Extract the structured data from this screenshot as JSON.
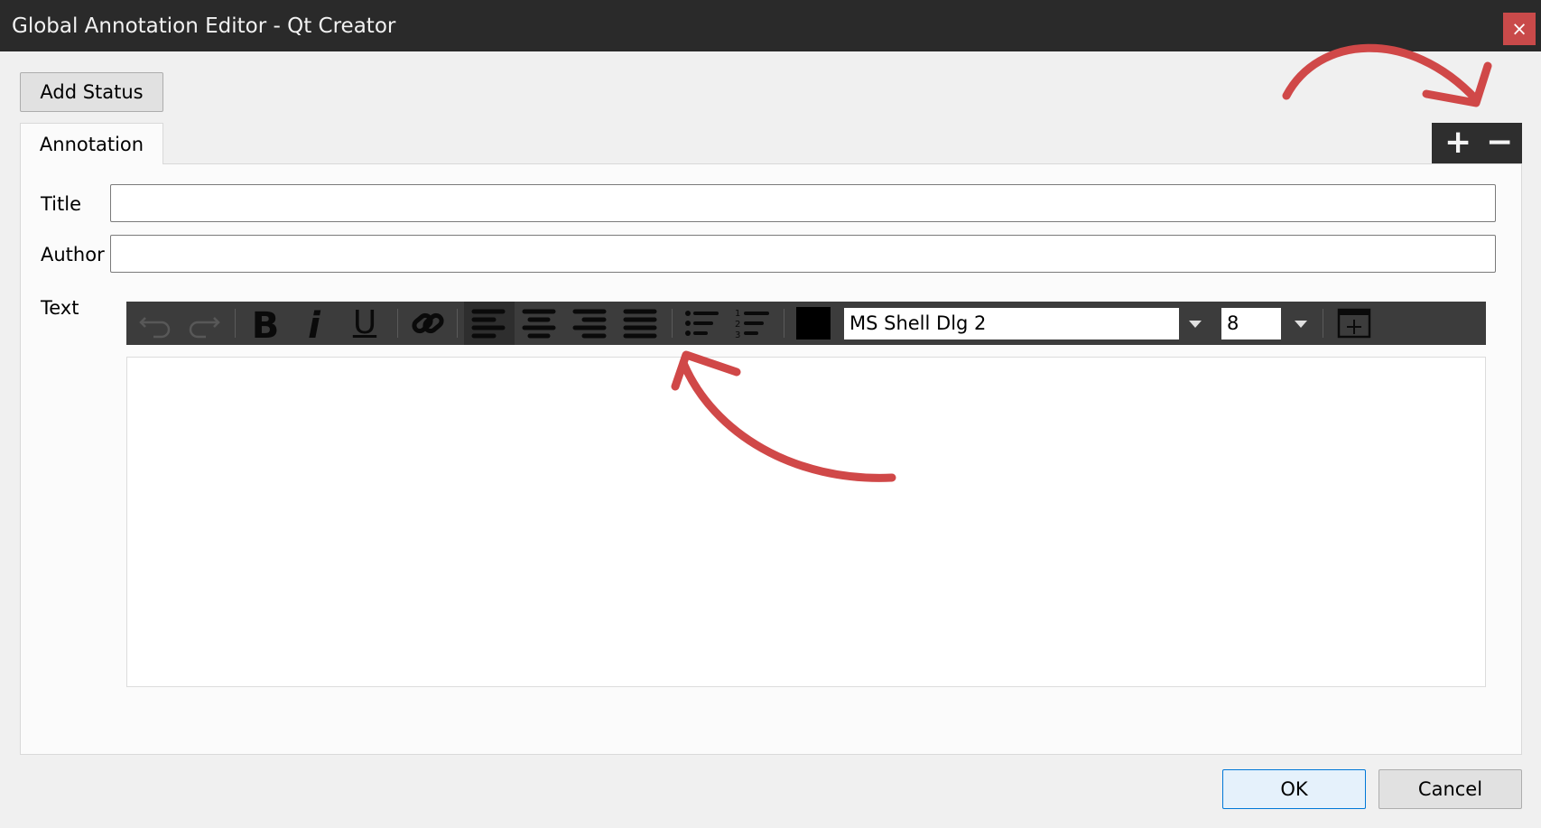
{
  "window": {
    "title": "Global Annotation Editor - Qt Creator",
    "close_glyph": "×"
  },
  "toolbar": {
    "add_status_label": "Add Status"
  },
  "tabs": [
    {
      "label": "Annotation"
    }
  ],
  "tab_controls": {
    "add_glyph": "+",
    "remove_glyph": "−"
  },
  "form": {
    "title_label": "Title",
    "title_value": "",
    "author_label": "Author",
    "author_value": "",
    "text_label": "Text"
  },
  "editor_toolbar": {
    "icons": [
      "undo-icon",
      "redo-icon",
      "bold-icon",
      "italic-icon",
      "underline-icon",
      "link-icon",
      "align-left-icon",
      "align-center-icon",
      "align-right-icon",
      "justify-icon",
      "bullet-list-icon",
      "numbered-list-icon",
      "text-color-swatch",
      "table-icon"
    ],
    "bold_glyph": "B",
    "italic_glyph": "i",
    "underline_glyph": "U",
    "text_color": "#000000",
    "font_family_value": "MS Shell Dlg 2",
    "font_size_value": "8"
  },
  "dialog": {
    "ok_label": "OK",
    "cancel_label": "Cancel"
  },
  "colors": {
    "titlebar": "#2a2a2a",
    "close_button": "#c94a4a",
    "toolbar": "#3c3c3c",
    "annotation_arrow": "#d04848"
  }
}
